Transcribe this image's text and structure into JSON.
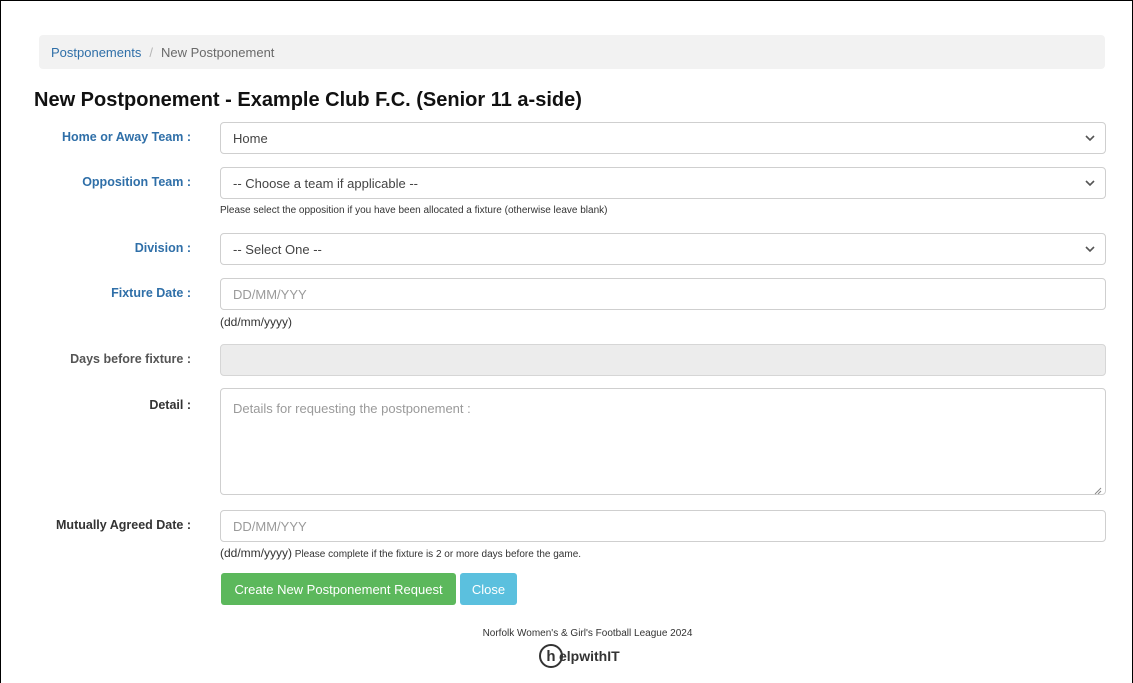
{
  "breadcrumb": {
    "parent": "Postponements",
    "separator": "/",
    "current": "New Postponement"
  },
  "page": {
    "title": "New Postponement - Example Club F.C. (Senior 11 a-side)"
  },
  "form": {
    "home_away": {
      "label": "Home or Away Team :",
      "value": "Home"
    },
    "opposition": {
      "label": "Opposition Team :",
      "value": "-- Choose a team if applicable --",
      "help": "Please select the opposition if you have been allocated a fixture (otherwise leave blank)"
    },
    "division": {
      "label": "Division :",
      "value": "-- Select One --"
    },
    "fixture_date": {
      "label": "Fixture Date :",
      "placeholder": "DD/MM/YYY",
      "format_hint": "(dd/mm/yyyy)"
    },
    "days_before": {
      "label": "Days before fixture :",
      "value": ""
    },
    "detail": {
      "label": "Detail :",
      "placeholder": "Details for requesting the postponement :"
    },
    "agreed_date": {
      "label": "Mutually Agreed Date :",
      "placeholder": "DD/MM/YYY",
      "format_hint": "(dd/mm/yyyy)",
      "help": "Please complete if the fixture is 2 or more days before the game."
    }
  },
  "buttons": {
    "create": "Create New Postponement Request",
    "close": "Close"
  },
  "footer": {
    "text": "Norfolk Women's & Girl's Football League 2024",
    "logo_mark": "h",
    "logo_text": "elpwithIT"
  },
  "colors": {
    "label_blue": "#2f6fa8",
    "button_green": "#5cb85c",
    "button_cyan": "#5bc0de",
    "breadcrumb_bg": "#f2f2f2",
    "disabled_bg": "#ececec"
  },
  "icons": {
    "select_caret": "chevron-down-icon",
    "textarea_resize": "resize-handle-icon"
  }
}
